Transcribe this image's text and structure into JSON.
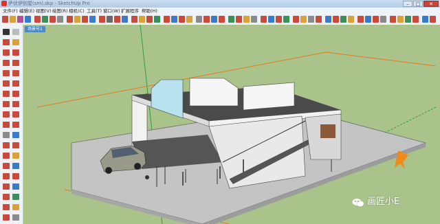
{
  "window": {
    "title": "萨伏伊别墅(sm).skp - SketchUp Pro",
    "minimize_label": "–",
    "maximize_label": "□",
    "close_label": "✕"
  },
  "menu": {
    "items": [
      "文件(F)",
      "编辑(E)",
      "视图(V)",
      "绘图(R)",
      "相机(C)",
      "工具(T)",
      "窗口(W)",
      "扩展程序",
      "帮助(H)"
    ]
  },
  "scene_tab": {
    "label": "场景号1"
  },
  "watermark": {
    "text": "画匠小E",
    "icon": "wechat-icon"
  },
  "colors": {
    "sky": "#a9c38a",
    "ground": "#c4c4c4",
    "axis_red": "#c0392b",
    "axis_green": "#2e9a4e",
    "axis_blue": "#3b6fd0",
    "axis_orange": "#e07a1b",
    "tab": "#4d89c7"
  }
}
